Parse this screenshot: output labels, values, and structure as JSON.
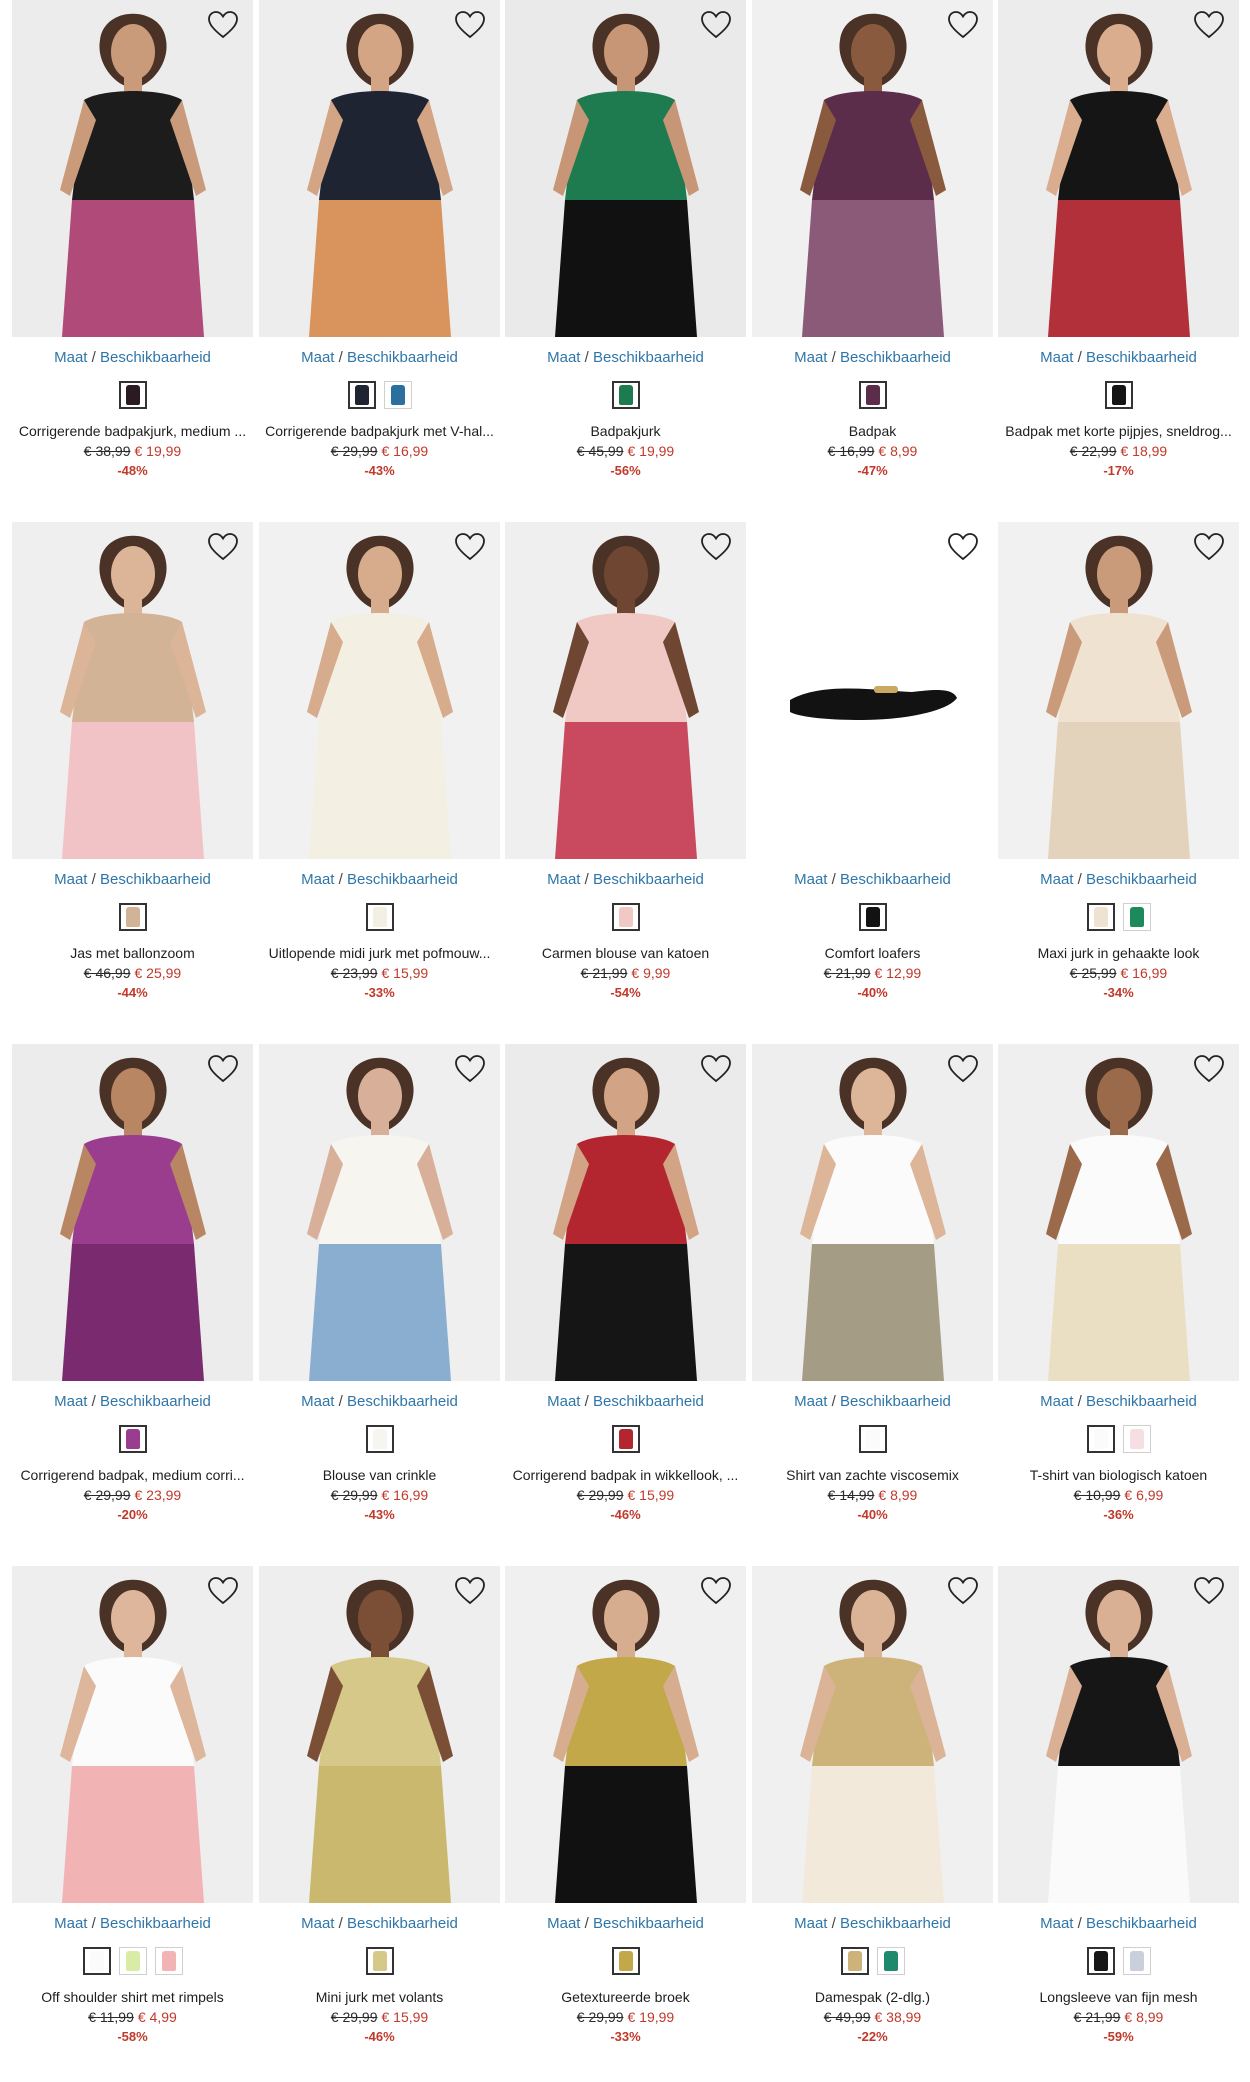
{
  "size_label": "Maat",
  "availability_label": "Beschikbaarheid",
  "separator": "/",
  "products": [
    {
      "name": "Corrigerende badpakjurk, medium ...",
      "old_price": "€ 38,99",
      "new_price": "€ 19,99",
      "discount": "-48%",
      "bg": "#ececec",
      "c1": "#1c1c1c",
      "c2": "#b04a78",
      "skin": "#c99b7b",
      "swatches": [
        "#2a1a22"
      ]
    },
    {
      "name": "Corrigerende badpakjurk met V-hal...",
      "old_price": "€ 29,99",
      "new_price": "€ 16,99",
      "discount": "-43%",
      "bg": "#ededed",
      "c1": "#1f2433",
      "c2": "#d9935c",
      "skin": "#d3a585",
      "swatches": [
        "#1f2433",
        "#2b6f9e"
      ]
    },
    {
      "name": "Badpakjurk",
      "old_price": "€ 45,99",
      "new_price": "€ 19,99",
      "discount": "-56%",
      "bg": "#eaeaea",
      "c1": "#1e7a4f",
      "c2": "#111111",
      "skin": "#c79676",
      "swatches": [
        "#1e7a4f"
      ]
    },
    {
      "name": "Badpak",
      "old_price": "€ 16,99",
      "new_price": "€ 8,99",
      "discount": "-47%",
      "bg": "#f0f0f0",
      "c1": "#5b2d4b",
      "c2": "#8b5a78",
      "skin": "#8a5a3e",
      "swatches": [
        "#5b2d4b"
      ]
    },
    {
      "name": "Badpak met korte pijpjes, sneldrog...",
      "old_price": "€ 22,99",
      "new_price": "€ 18,99",
      "discount": "-17%",
      "bg": "#ececec",
      "c1": "#151515",
      "c2": "#b2303a",
      "skin": "#d9ad8e",
      "swatches": [
        "#151515"
      ]
    },
    {
      "name": "Jas met ballonzoom",
      "old_price": "€ 46,99",
      "new_price": "€ 25,99",
      "discount": "-44%",
      "bg": "#efefef",
      "c1": "#d2b395",
      "c2": "#f2c3c6",
      "skin": "#dcb498",
      "swatches": [
        "#d2b395"
      ]
    },
    {
      "name": "Uitlopende midi jurk met pofmouw...",
      "old_price": "€ 23,99",
      "new_price": "€ 15,99",
      "discount": "-33%",
      "bg": "#f1f1f1",
      "c1": "#f3efe2",
      "c2": "#f3efe2",
      "skin": "#d7ac8c",
      "swatches": [
        "#f3efe2"
      ]
    },
    {
      "name": "Carmen blouse van katoen",
      "old_price": "€ 21,99",
      "new_price": "€ 9,99",
      "discount": "-54%",
      "bg": "#efefef",
      "c1": "#f0c8c4",
      "c2": "#c94a5f",
      "skin": "#6e4632",
      "swatches": [
        "#f0c8c4"
      ]
    },
    {
      "name": "Comfort loafers",
      "old_price": "€ 21,99",
      "new_price": "€ 12,99",
      "discount": "-40%",
      "bg": "#ffffff",
      "c1": "#121212",
      "c2": "#c9a862",
      "skin": "#ffffff",
      "swatches": [
        "#121212"
      ]
    },
    {
      "name": "Maxi jurk in gehaakte look",
      "old_price": "€ 25,99",
      "new_price": "€ 16,99",
      "discount": "-34%",
      "bg": "#f1f1f1",
      "c1": "#efe2d0",
      "c2": "#e3d2bc",
      "skin": "#c99b7b",
      "swatches": [
        "#efe2d0",
        "#1d8a5e"
      ]
    },
    {
      "name": "Corrigerend badpak, medium corri...",
      "old_price": "€ 29,99",
      "new_price": "€ 23,99",
      "discount": "-20%",
      "bg": "#ececec",
      "c1": "#9a3d8e",
      "c2": "#7a2a6e",
      "skin": "#b98663",
      "swatches": [
        "#9a3d8e"
      ]
    },
    {
      "name": "Blouse van crinkle",
      "old_price": "€ 29,99",
      "new_price": "€ 16,99",
      "discount": "-43%",
      "bg": "#efefef",
      "c1": "#f7f5ef",
      "c2": "#8aaed0",
      "skin": "#d8b09a",
      "swatches": [
        "#f7f5ef"
      ]
    },
    {
      "name": "Corrigerend badpak in wikkellook, ...",
      "old_price": "€ 29,99",
      "new_price": "€ 15,99",
      "discount": "-46%",
      "bg": "#ebebeb",
      "c1": "#b4262f",
      "c2": "#151515",
      "skin": "#d2a385",
      "swatches": [
        "#b4262f"
      ]
    },
    {
      "name": "Shirt van zachte viscosemix",
      "old_price": "€ 14,99",
      "new_price": "€ 8,99",
      "discount": "-40%",
      "bg": "#eeeeee",
      "c1": "#fbfbfb",
      "c2": "#a59c86",
      "skin": "#ddb699",
      "swatches": [
        "#fbfbfb"
      ]
    },
    {
      "name": "T-shirt van biologisch katoen",
      "old_price": "€ 10,99",
      "new_price": "€ 6,99",
      "discount": "-36%",
      "bg": "#efefef",
      "c1": "#fbfbfb",
      "c2": "#eadfc3",
      "skin": "#9a6a4b",
      "swatches": [
        "#fbfbfb",
        "#f5dfe2"
      ]
    },
    {
      "name": "Off shoulder shirt met rimpels",
      "old_price": "€ 11,99",
      "new_price": "€ 4,99",
      "discount": "-58%",
      "bg": "#eeeeee",
      "c1": "#fbfbfb",
      "c2": "#f2b3b5",
      "skin": "#deb69c",
      "swatches": [
        "#fbfbfb",
        "#d9eca6",
        "#f2b3b5"
      ]
    },
    {
      "name": "Mini jurk met volants",
      "old_price": "€ 29,99",
      "new_price": "€ 15,99",
      "discount": "-46%",
      "bg": "#eeeeee",
      "c1": "#d6c889",
      "c2": "#c9b86e",
      "skin": "#7b4f36",
      "swatches": [
        "#d6c889"
      ]
    },
    {
      "name": "Getextureerde broek",
      "old_price": "€ 29,99",
      "new_price": "€ 19,99",
      "discount": "-33%",
      "bg": "#f0f0f0",
      "c1": "#c3a84a",
      "c2": "#111111",
      "skin": "#d7ad8f",
      "swatches": [
        "#c3a84a"
      ]
    },
    {
      "name": "Damespak (2-dlg.)",
      "old_price": "€ 49,99",
      "new_price": "€ 38,99",
      "discount": "-22%",
      "bg": "#f0f0f0",
      "c1": "#cdb27a",
      "c2": "#f2e9da",
      "skin": "#dbb497",
      "swatches": [
        "#cdb27a",
        "#1d8a6e"
      ]
    },
    {
      "name": "Longsleeve van fijn mesh",
      "old_price": "€ 21,99",
      "new_price": "€ 8,99",
      "discount": "-59%",
      "bg": "#eeeeee",
      "c1": "#161616",
      "c2": "#fafafa",
      "skin": "#d9b093",
      "swatches": [
        "#161616",
        "#c9d0dc"
      ]
    }
  ]
}
